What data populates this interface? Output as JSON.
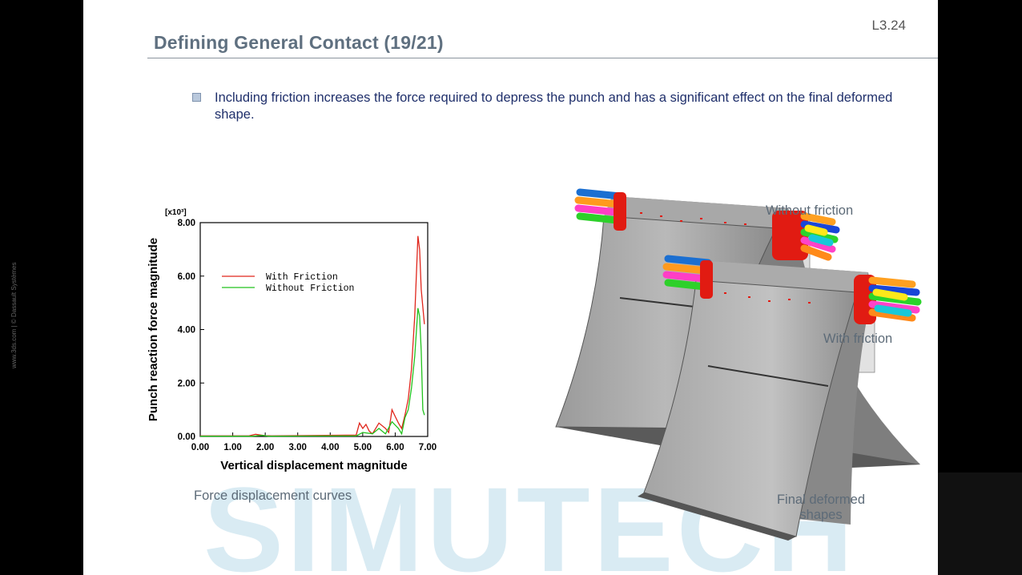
{
  "slide_number": "L3.24",
  "title": "Defining General Contact (19/21)",
  "bullet": "Including friction increases the force required to depress the punch and has a significant effect on the final deformed shape.",
  "side_text": "www.3ds.com | © Dassault Systèmes",
  "watermark": "SIMUTECH",
  "captions": {
    "force_curves": "Force displacement curves",
    "without_friction": "Without friction",
    "with_friction": "With friction",
    "final_shapes_line1": "Final deformed",
    "final_shapes_line2": "shapes"
  },
  "chart_data": {
    "type": "line",
    "xlabel": "Vertical displacement magnitude",
    "ylabel": "Punch reaction force magnitude",
    "y_multiplier_label": "[x10³]",
    "xlim": [
      0,
      7
    ],
    "ylim": [
      0,
      8
    ],
    "x_ticks": [
      "0.00",
      "1.00",
      "2.00",
      "3.00",
      "4.00",
      "5.00",
      "6.00",
      "7.00"
    ],
    "y_ticks": [
      "0.00",
      "2.00",
      "4.00",
      "6.00",
      "8.00"
    ],
    "series": [
      {
        "name": "With Friction",
        "color": "#e0261c",
        "x": [
          0,
          1.5,
          1.7,
          2.0,
          2.2,
          4.8,
          4.9,
          5.0,
          5.1,
          5.2,
          5.3,
          5.5,
          5.7,
          5.8,
          5.9,
          6.0,
          6.1,
          6.2,
          6.3,
          6.4,
          6.5,
          6.6,
          6.7,
          6.75,
          6.8,
          6.9
        ],
        "y": [
          0.02,
          0.02,
          0.08,
          0.03,
          0.02,
          0.05,
          0.5,
          0.3,
          0.45,
          0.2,
          0.1,
          0.5,
          0.3,
          0.15,
          1.0,
          0.75,
          0.5,
          0.3,
          0.8,
          1.4,
          2.5,
          4.5,
          7.5,
          7.0,
          5.5,
          4.2
        ]
      },
      {
        "name": "Without Friction",
        "color": "#22c21e",
        "x": [
          0,
          1.6,
          1.9,
          2.1,
          4.8,
          5.0,
          5.3,
          5.5,
          5.7,
          5.9,
          6.1,
          6.2,
          6.3,
          6.4,
          6.5,
          6.6,
          6.7,
          6.75,
          6.8,
          6.85,
          6.9
        ],
        "y": [
          0.01,
          0.01,
          0.04,
          0.01,
          0.02,
          0.15,
          0.1,
          0.3,
          0.1,
          0.55,
          0.3,
          0.1,
          0.7,
          1.0,
          1.8,
          3.0,
          4.8,
          4.5,
          3.2,
          1.0,
          0.8
        ]
      }
    ]
  }
}
